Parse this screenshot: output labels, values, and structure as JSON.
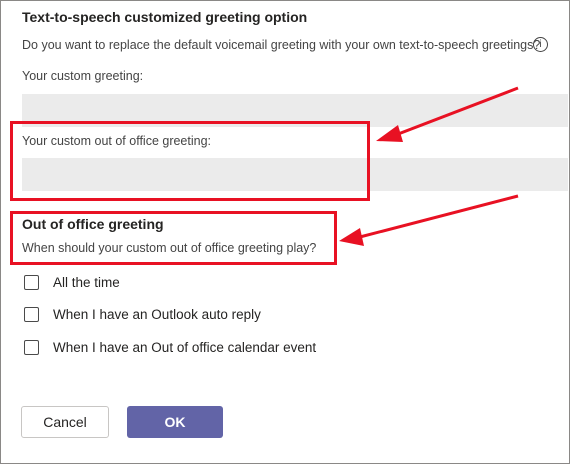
{
  "tts_section": {
    "title": "Text-to-speech customized greeting option",
    "question": "Do you want to replace the default voicemail greeting with your own text-to-speech greetings?",
    "info_icon": "i"
  },
  "custom_greeting": {
    "label": "Your custom greeting:",
    "value": ""
  },
  "ooo_custom_greeting": {
    "label": "Your custom out of office greeting:",
    "value": ""
  },
  "ooo_section": {
    "title": "Out of office greeting",
    "question": "When should your custom out of office greeting play?"
  },
  "options": [
    {
      "label": "All the time",
      "checked": false
    },
    {
      "label": "When I have an Outlook auto reply",
      "checked": false
    },
    {
      "label": "When I have an Out of office calendar event",
      "checked": false
    }
  ],
  "buttons": {
    "cancel": "Cancel",
    "ok": "OK"
  },
  "colors": {
    "primary": "#6264a7",
    "highlight": "#e81123",
    "field_bg": "#ebebeb"
  }
}
